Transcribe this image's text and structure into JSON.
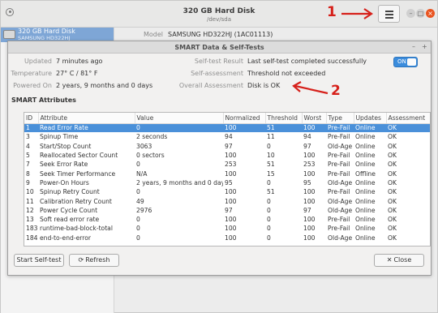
{
  "window": {
    "title": "320 GB Hard Disk",
    "subtitle": "/dev/sda"
  },
  "sidebar": {
    "disk_name": "320 GB Hard Disk",
    "disk_model": "SAMSUNG HD322HJ"
  },
  "detail": {
    "model_label": "Model",
    "model_value": "SAMSUNG HD322HJ (1AC01113)"
  },
  "annotations": {
    "arrow_1": "1",
    "arrow_2": "2",
    "color": "#d6201a"
  },
  "dialog": {
    "title": "SMART Data & Self-Tests",
    "updated_label": "Updated",
    "updated_value": "7 minutes ago",
    "temperature_label": "Temperature",
    "temperature_value": "27° C / 81° F",
    "powered_on_label": "Powered On",
    "powered_on_value": "2 years, 9 months and 0 days",
    "self_test_result_label": "Self-test Result",
    "self_test_result_value": "Last self-test completed successfully",
    "self_assessment_label": "Self-assessment",
    "self_assessment_value": "Threshold not exceeded",
    "overall_label": "Overall Assessment",
    "overall_value": "Disk is OK",
    "toggle_label": "ON",
    "toggle_color": "#3b8cdc",
    "section_title": "SMART Attributes",
    "start_button": "Start Self-test",
    "refresh_button": "Refresh",
    "close_button": "Close"
  },
  "table": {
    "headers": [
      "ID",
      "Attribute",
      "Value",
      "Normalized",
      "Threshold",
      "Worst",
      "Type",
      "Updates",
      "Assessment"
    ],
    "rows": [
      [
        "1",
        "Read Error Rate",
        "0",
        "100",
        "51",
        "100",
        "Pre-Fail",
        "Online",
        "OK"
      ],
      [
        "3",
        "Spinup Time",
        "2 seconds",
        "94",
        "11",
        "94",
        "Pre-Fail",
        "Online",
        "OK"
      ],
      [
        "4",
        "Start/Stop Count",
        "3063",
        "97",
        "0",
        "97",
        "Old-Age",
        "Online",
        "OK"
      ],
      [
        "5",
        "Reallocated Sector Count",
        "0 sectors",
        "100",
        "10",
        "100",
        "Pre-Fail",
        "Online",
        "OK"
      ],
      [
        "7",
        "Seek Error Rate",
        "0",
        "253",
        "51",
        "253",
        "Pre-Fail",
        "Online",
        "OK"
      ],
      [
        "8",
        "Seek Timer Performance",
        "N/A",
        "100",
        "15",
        "100",
        "Pre-Fail",
        "Offline",
        "OK"
      ],
      [
        "9",
        "Power-On Hours",
        "2 years, 9 months and 0 days",
        "95",
        "0",
        "95",
        "Old-Age",
        "Online",
        "OK"
      ],
      [
        "10",
        "Spinup Retry Count",
        "0",
        "100",
        "51",
        "100",
        "Pre-Fail",
        "Online",
        "OK"
      ],
      [
        "11",
        "Calibration Retry Count",
        "49",
        "100",
        "0",
        "100",
        "Old-Age",
        "Online",
        "OK"
      ],
      [
        "12",
        "Power Cycle Count",
        "2976",
        "97",
        "0",
        "97",
        "Old-Age",
        "Online",
        "OK"
      ],
      [
        "13",
        "Soft read error rate",
        "0",
        "100",
        "0",
        "100",
        "Pre-Fail",
        "Online",
        "OK"
      ],
      [
        "183",
        "runtime-bad-block-total",
        "0",
        "100",
        "0",
        "100",
        "Pre-Fail",
        "Online",
        "OK"
      ],
      [
        "184",
        "end-to-end-error",
        "0",
        "100",
        "0",
        "100",
        "Old-Age",
        "Online",
        "OK"
      ]
    ],
    "selected_row": 0
  }
}
